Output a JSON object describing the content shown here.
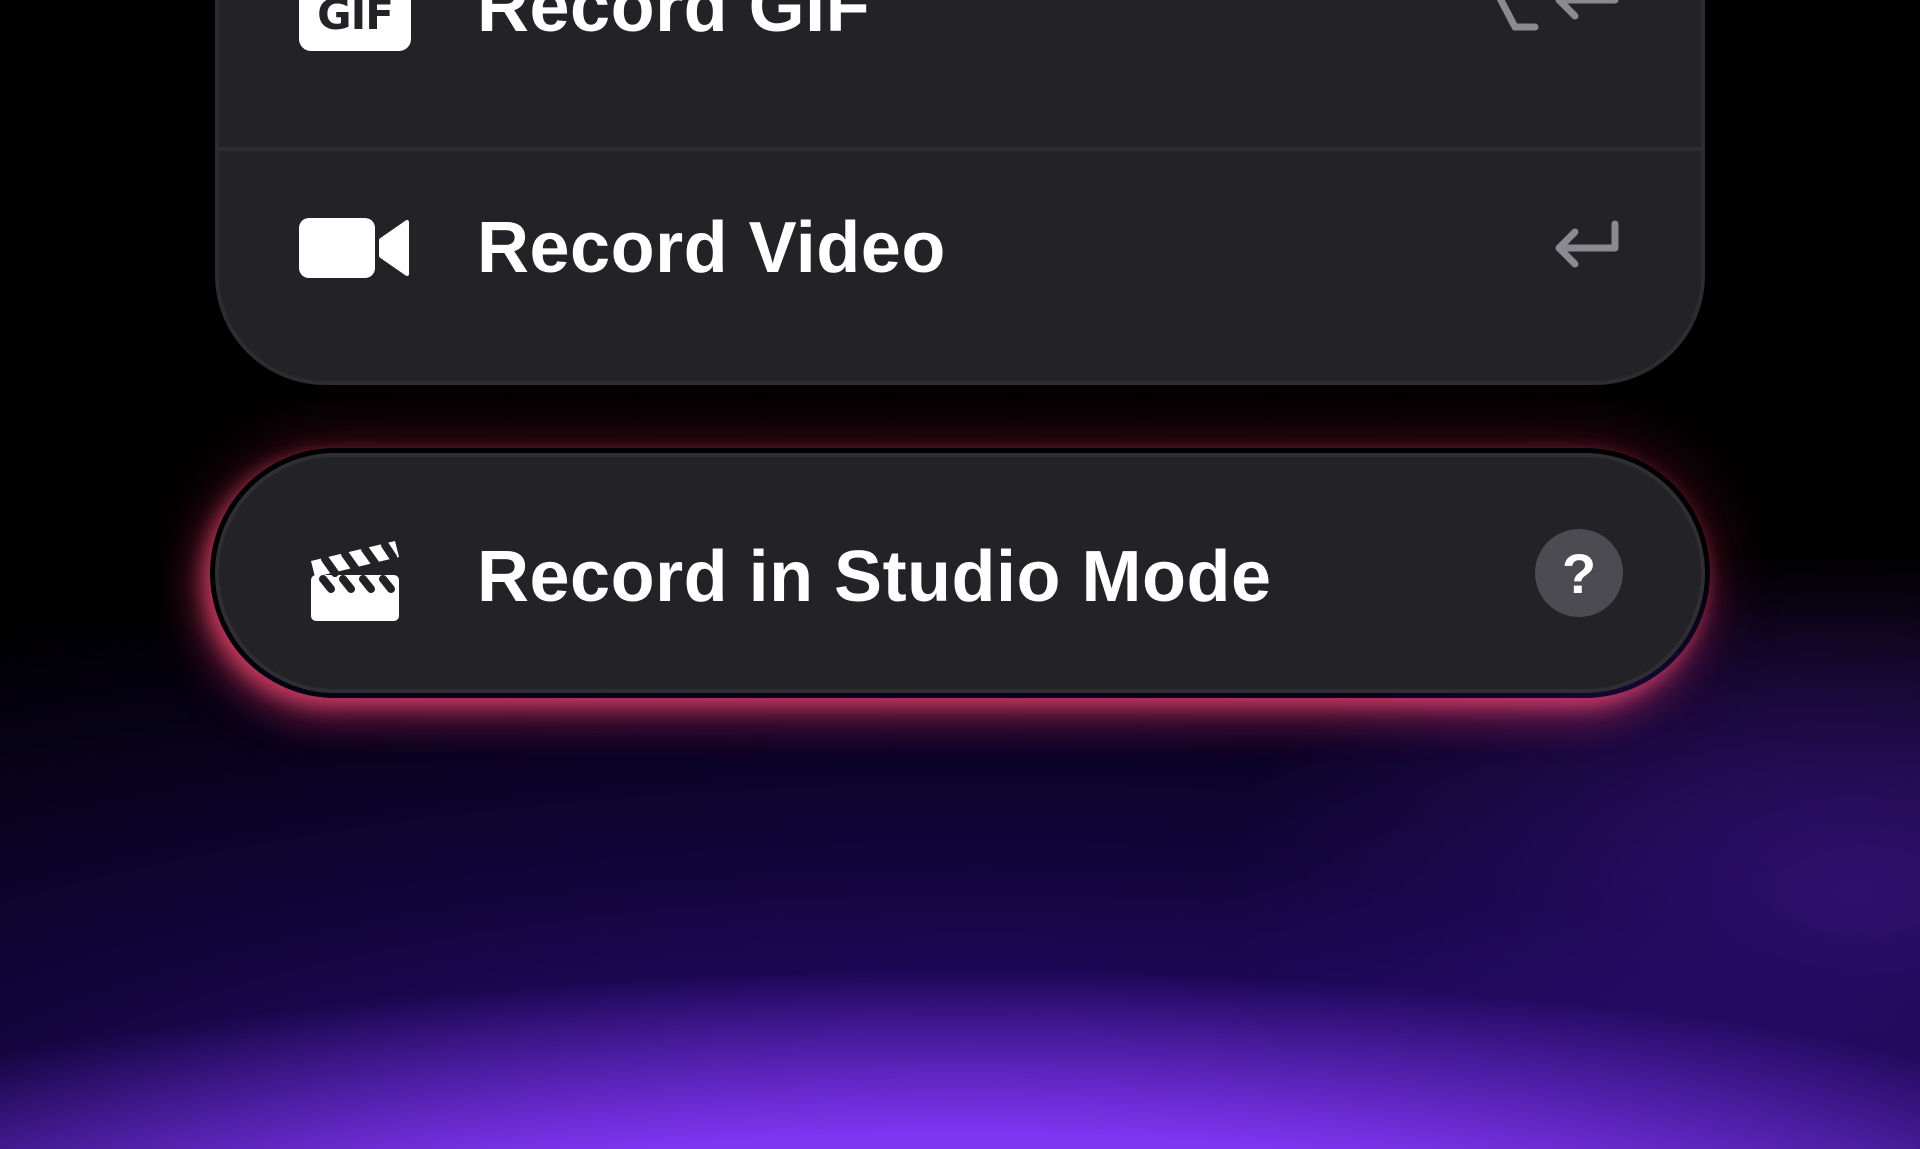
{
  "menu": {
    "items": [
      {
        "label": "Record GIF",
        "icon": "gif-icon",
        "badge_text": "GIF",
        "shortcut_icons": [
          "option-key-icon",
          "return-key-icon"
        ]
      },
      {
        "label": "Record Video",
        "icon": "video-camera-icon",
        "shortcut_icons": [
          "return-key-icon"
        ]
      }
    ]
  },
  "studio": {
    "label": "Record in Studio Mode",
    "icon": "clapperboard-icon",
    "help_label": "?",
    "help_icon": "question-mark-icon"
  },
  "colors": {
    "panel": "#232327",
    "glow": "#e63c6e",
    "background_accent": "#8a3cff",
    "shortcut": "#8a8a90"
  }
}
